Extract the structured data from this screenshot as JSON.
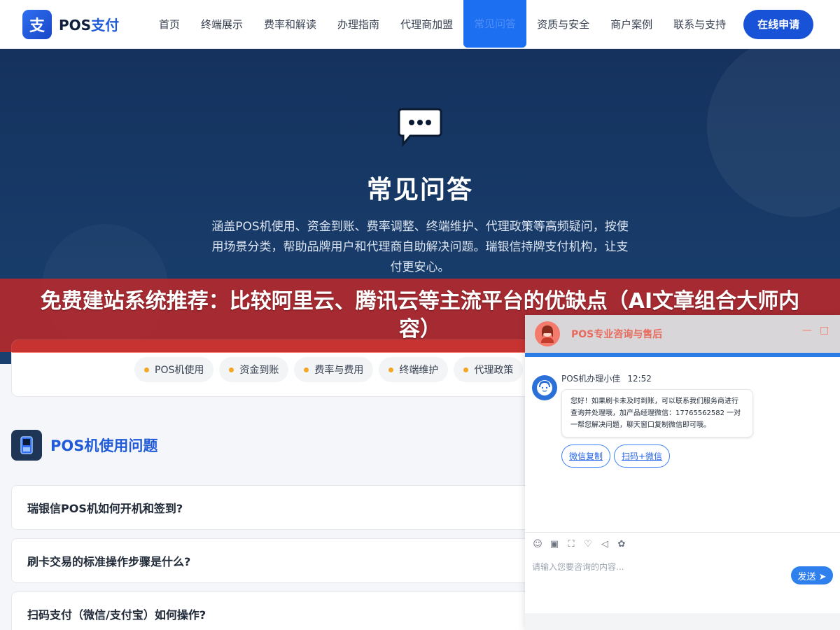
{
  "header": {
    "logo_mark": "支",
    "logo_text_a": "POS",
    "logo_text_b": "支付",
    "nav": [
      "首页",
      "终端展示",
      "费率和解读",
      "办理指南",
      "代理商加盟",
      "常见问答",
      "资质与安全",
      "商户案例",
      "联系与支持"
    ],
    "active_index": 5,
    "apply_label": "在线申请"
  },
  "hero": {
    "title": "常见问答",
    "description": "涵盖POS机使用、资金到账、费率调整、终端维护、代理政策等高频疑问，按使用场景分类，帮助品牌用户和代理商自助解决问题。瑞银信持牌支付机构，让支付更安心。"
  },
  "banner": {
    "text": "免费建站系统推荐：比较阿里云、腾讯云等主流平台的优缺点（AI文章组合大师内容）"
  },
  "categories": [
    "POS机使用",
    "资金到账",
    "费率与费用",
    "终端维护",
    "代理政策"
  ],
  "section": {
    "title": "POS机使用问题",
    "questions": [
      "瑞银信POS机如何开机和签到?",
      "刷卡交易的标准操作步骤是什么?",
      "扫码支付（微信/支付宝）如何操作?"
    ]
  },
  "chat": {
    "title": "POS专业咨询与售后",
    "minimize": "—",
    "maximize": "□",
    "agent_name": "POS机办理小佳",
    "time": "12:52",
    "message": "您好！如果刷卡未及时到账，可以联系我们服务商进行查询并处理哦，加产品经理微信：17765562582 一对一帮您解决问题，聊天窗口复制微信即可哦。",
    "buttons": [
      "微信复制",
      "扫码+微信"
    ],
    "input_placeholder": "请输入您要咨询的内容...",
    "send_label": "发送 ➤",
    "tools": [
      "☺",
      "▣",
      "⛶",
      "♡",
      "◁",
      "✿"
    ]
  },
  "colors": {
    "brand": "#1852d6",
    "hero_bg": "#15325e",
    "banner": "#be2828",
    "chat_accent": "#f47a6b"
  }
}
